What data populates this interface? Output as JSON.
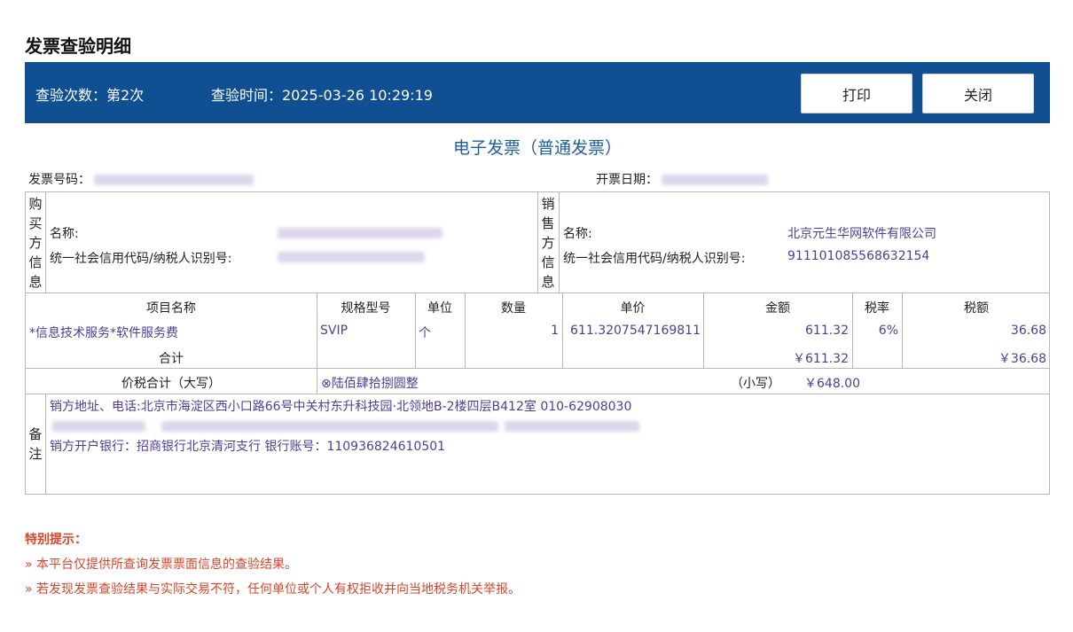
{
  "page": {
    "title": "发票查验明细"
  },
  "header": {
    "check_count_label": "查验次数：第2次",
    "check_time_label": "查验时间：2025-03-26 10:29:19",
    "print_button": "打印",
    "close_button": "关闭"
  },
  "invoice": {
    "type": "电子发票（普通发票）",
    "number_label": "发票号码：",
    "date_label": "开票日期：",
    "buyer": {
      "section_label": [
        "购",
        "买",
        "方",
        "信",
        "息"
      ],
      "name_label": "名称:",
      "tax_id_label": "统一社会信用代码/纳税人识别号:"
    },
    "seller": {
      "section_label": [
        "销",
        "售",
        "方",
        "信",
        "息"
      ],
      "name_label": "名称:",
      "name": "北京元生华网软件有限公司",
      "tax_id_label": "统一社会信用代码/纳税人识别号:",
      "tax_id": "911101085568632154"
    },
    "columns": [
      "项目名称",
      "规格型号",
      "单位",
      "数量",
      "单价",
      "金额",
      "税率",
      "税额"
    ],
    "items": [
      {
        "name": "*信息技术服务*软件服务费",
        "spec": "SVIP",
        "unit": "个",
        "qty": "1",
        "price": "611.3207547169811",
        "amount": "611.32",
        "rate": "6%",
        "tax": "36.68"
      }
    ],
    "subtotal": {
      "label": "合计",
      "amount": "￥611.32",
      "tax": "￥36.68"
    },
    "total": {
      "label": "价税合计（大写）",
      "upper": "⊗陆佰肆拾捌圆整",
      "lower_label": "（小写）",
      "lower": "￥648.00"
    },
    "remarks": {
      "label": [
        "备",
        "注"
      ],
      "line1": "销方地址、电话:北京市海淀区西小口路66号中关村东升科技园·北领地B-2楼四层B412室 010-62908030",
      "line3": "销方开户银行：招商银行北京清河支行 银行账号：110936824610501"
    }
  },
  "tips": {
    "title": "特别提示：",
    "items": [
      "»  本平台仅提供所查询发票票面信息的查验结果。",
      "»  若发现发票查验结果与实际交易不符，任何单位或个人有权拒收并向当地税务机关举报。"
    ]
  }
}
